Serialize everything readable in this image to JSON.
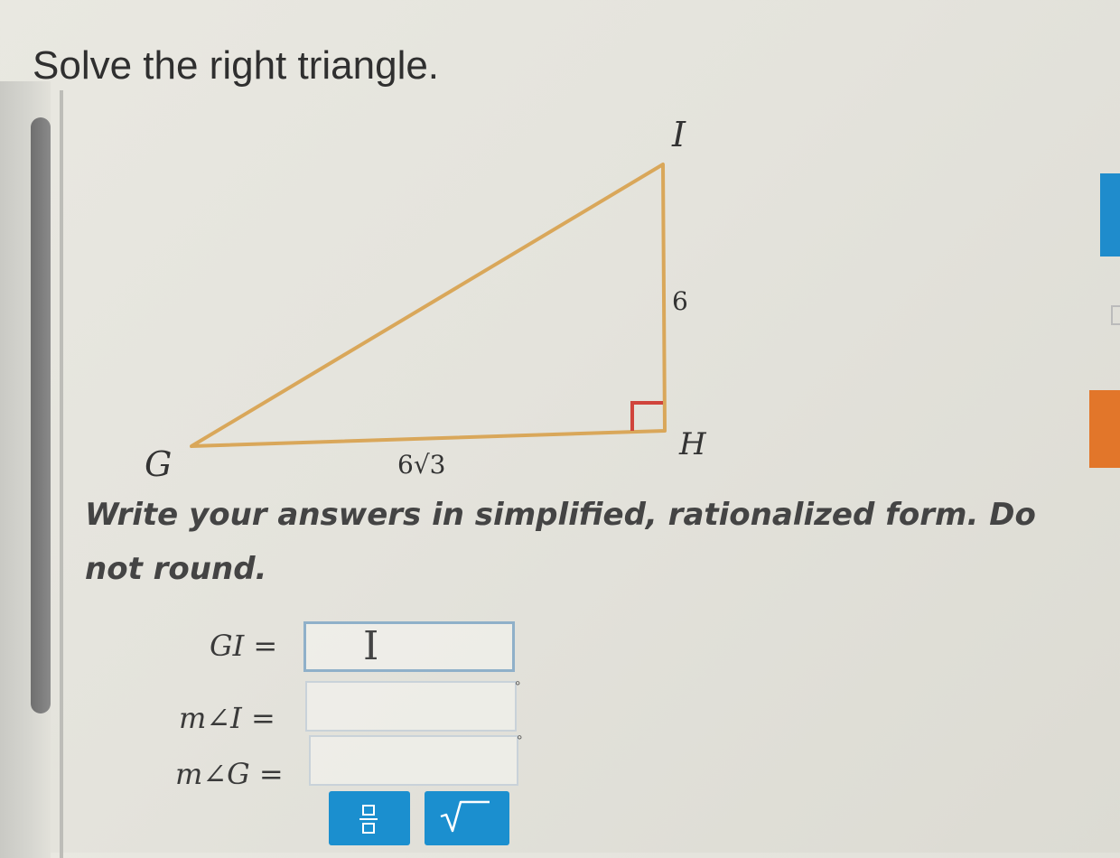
{
  "question": {
    "title": "Solve the right triangle.",
    "instructions": "Write your answers in simplified, rationalized form. Do not round."
  },
  "triangle": {
    "vertices": {
      "g": "G",
      "h": "H",
      "i": "I"
    },
    "sides": {
      "ih": "6",
      "gh": "6√3"
    }
  },
  "answers": [
    {
      "label": "GI =",
      "value": "",
      "unit": ""
    },
    {
      "label": "m∠I =",
      "value": "",
      "unit": "°"
    },
    {
      "label": "m∠G =",
      "value": "",
      "unit": "°"
    }
  ],
  "toolbar": {
    "fraction_icon": "fraction-icon",
    "sqrt_icon": "sqrt-icon"
  },
  "colors": {
    "triangle_stroke": "#d9a75a",
    "right_angle_mark": "#d0443c",
    "accent_blue": "#1b8fcf",
    "side_badge": "#e2762a"
  }
}
